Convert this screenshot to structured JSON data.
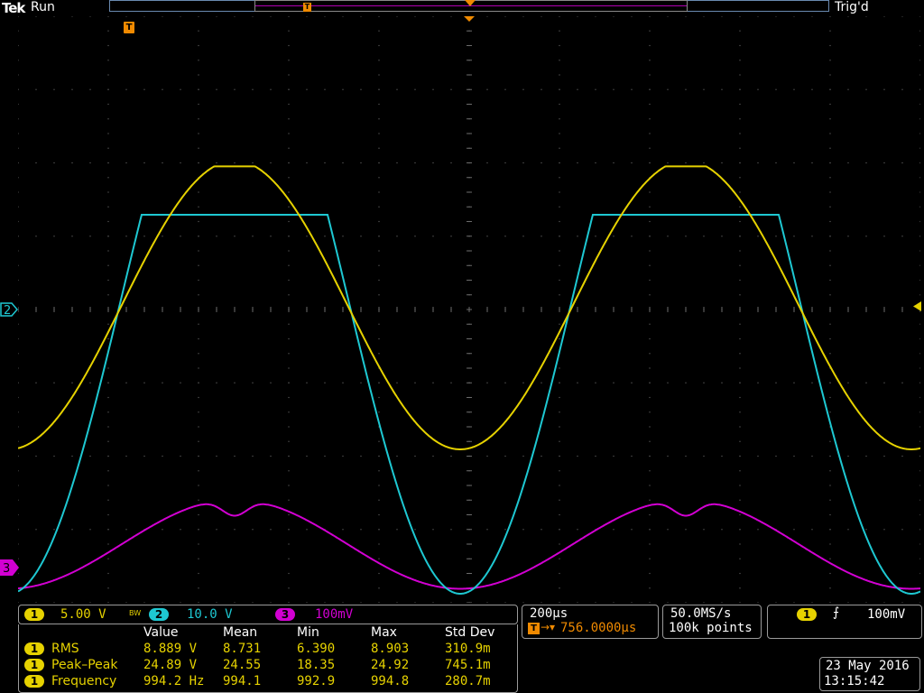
{
  "status": {
    "brand": "Tek",
    "run_state": "Run",
    "trigger_state": "Trig'd"
  },
  "markers": {
    "trigger_position_glyph": "T",
    "record_trigger_glyph": "T",
    "ch2_marker": "2",
    "ch3_marker": "3"
  },
  "channels": [
    {
      "number": "1",
      "scale": "5.00 V",
      "color": "#e6d200",
      "bw_limit": "BW"
    },
    {
      "number": "2",
      "scale": "10.0 V",
      "color": "#1ec8d2"
    },
    {
      "number": "3",
      "scale": "100mV",
      "color": "#d200d2"
    }
  ],
  "measurements": {
    "headers": [
      "Value",
      "Mean",
      "Min",
      "Max",
      "Std Dev"
    ],
    "rows": [
      {
        "channel": "1",
        "name": "RMS",
        "value": "8.889 V",
        "mean": "8.731",
        "min": "6.390",
        "max": "8.903",
        "std_dev": "310.9m"
      },
      {
        "channel": "1",
        "name": "Peak–Peak",
        "value": "24.89 V",
        "mean": "24.55",
        "min": "18.35",
        "max": "24.92",
        "std_dev": "745.1m"
      },
      {
        "channel": "1",
        "name": "Frequency",
        "value": "994.2 Hz",
        "mean": "994.1",
        "min": "992.9",
        "max": "994.8",
        "std_dev": "280.7m"
      }
    ]
  },
  "horizontal": {
    "time_per_div": "200µs",
    "trigger_delay": "756.0000µs",
    "sample_rate": "50.0MS/s",
    "record_length": "100k points"
  },
  "trigger": {
    "source": "1",
    "slope_glyph": "⨍",
    "level": "100mV"
  },
  "datetime": {
    "date": "23 May 2016",
    "time": "13:15:42"
  },
  "colors": {
    "ch1": "#e6d200",
    "ch2": "#1ec8d2",
    "ch3": "#d200d2",
    "trigger": "#f08a00"
  }
}
